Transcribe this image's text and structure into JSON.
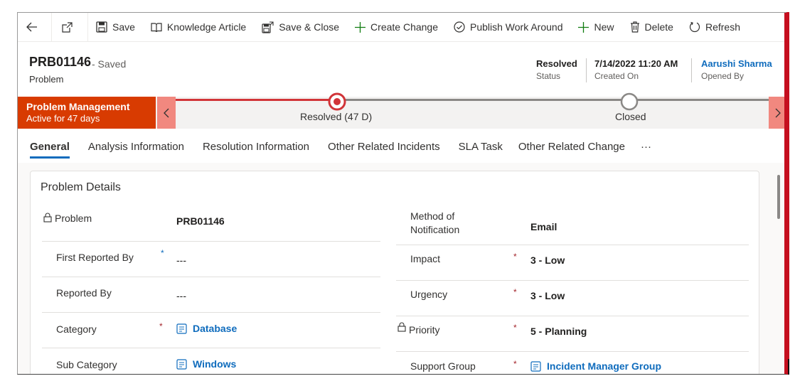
{
  "toolbar": {
    "back_label": "",
    "items": [
      {
        "label": "Save",
        "icon": "save-icon"
      },
      {
        "label": "Knowledge Article",
        "icon": "book-icon"
      },
      {
        "label": "Save & Close",
        "icon": "save-close-icon"
      },
      {
        "label": "Create Change",
        "icon": "plus-icon"
      },
      {
        "label": "Publish Work Around",
        "icon": "check-circle-icon"
      },
      {
        "label": "New",
        "icon": "plus-icon"
      },
      {
        "label": "Delete",
        "icon": "trash-icon"
      },
      {
        "label": "Refresh",
        "icon": "refresh-icon"
      }
    ]
  },
  "header": {
    "record_id": "PRB01146",
    "saved_status": "- Saved",
    "record_type": "Problem",
    "fields": [
      {
        "value": "Resolved",
        "label": "Status"
      },
      {
        "value": "7/14/2022 11:20 AM",
        "label": "Created On"
      },
      {
        "value": "Aarushi Sharma",
        "label": "Opened By"
      }
    ]
  },
  "bpf": {
    "process_name": "Problem Management",
    "active_for": "Active for 47 days",
    "stages": [
      {
        "label": "Resolved  (47 D)",
        "state": "active"
      },
      {
        "label": "Closed",
        "state": "pending"
      }
    ],
    "colors": {
      "process": "#d83b01",
      "active": "#d13438",
      "pending": "#8a8886"
    }
  },
  "tabs": [
    {
      "label": "General",
      "active": true
    },
    {
      "label": "Analysis Information",
      "active": false
    },
    {
      "label": "Resolution Information",
      "active": false
    },
    {
      "label": "Other Related Incidents",
      "active": false
    },
    {
      "label": "SLA Task",
      "active": false
    },
    {
      "label": "Other Related Change",
      "active": false
    },
    {
      "label": "···",
      "active": false
    }
  ],
  "section": {
    "title": "Problem Details",
    "left_fields": [
      {
        "label": "Problem",
        "value": "PRB01146",
        "locked": true,
        "required": "",
        "link": false
      },
      {
        "label": "First Reported By",
        "value": "---",
        "locked": false,
        "required": "*",
        "link": false
      },
      {
        "label": "Reported By",
        "value": "---",
        "locked": false,
        "required": "",
        "link": false
      },
      {
        "label": "Category",
        "value": "Database",
        "locked": false,
        "required": "*",
        "link": true
      },
      {
        "label": "Sub Category",
        "value": "Windows",
        "locked": false,
        "required": "",
        "link": true
      }
    ],
    "right_fields": [
      {
        "label": "Method of Notification",
        "value": "Email",
        "locked": false,
        "required": "",
        "link": false
      },
      {
        "label": "Impact",
        "value": "3 - Low",
        "locked": false,
        "required": "*",
        "link": false
      },
      {
        "label": "Urgency",
        "value": "3 - Low",
        "locked": false,
        "required": "*",
        "link": false
      },
      {
        "label": "Priority",
        "value": "5 - Planning",
        "locked": true,
        "required": "*",
        "link": false
      },
      {
        "label": "Support Group",
        "value": "Incident Manager Group",
        "locked": false,
        "required": "*",
        "link": true
      }
    ]
  }
}
